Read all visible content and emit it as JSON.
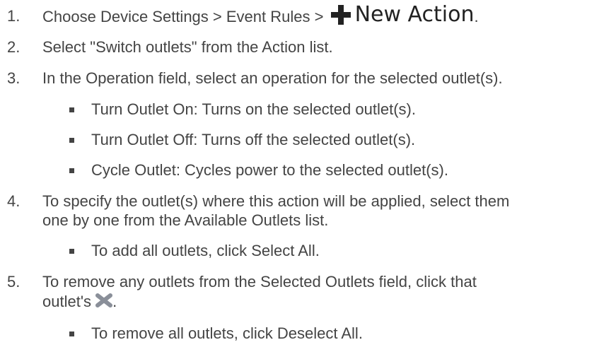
{
  "steps": [
    {
      "number": "1.",
      "text_before": "Choose Device Settings > Event Rules >",
      "button_label": "New Action",
      "text_after": "."
    },
    {
      "number": "2.",
      "text": "Select \"Switch outlets\" from the Action list."
    },
    {
      "number": "3.",
      "text": "In the Operation field, select an operation for the selected outlet(s).",
      "bullets": [
        "Turn Outlet On: Turns on the selected outlet(s).",
        "Turn Outlet Off: Turns off the selected outlet(s).",
        "Cycle Outlet: Cycles power to the selected outlet(s)."
      ]
    },
    {
      "number": "4.",
      "text_line1": "To specify the outlet(s) where this action will be applied, select them",
      "text_line2": "one by one from the Available Outlets list.",
      "bullets": [
        "To add all outlets, click Select All."
      ]
    },
    {
      "number": "5.",
      "text_line1": "To remove any outlets from the Selected Outlets field, click that",
      "text_line2": "outlet's",
      "text_after": ".",
      "bullets": [
        "To remove all outlets, click Deselect All."
      ]
    }
  ],
  "icons": {
    "new_action": "plus-icon",
    "remove": "close-icon"
  },
  "colors": {
    "text": "#444444",
    "icon_dark": "#222222",
    "x_icon": "#8a8f99"
  }
}
